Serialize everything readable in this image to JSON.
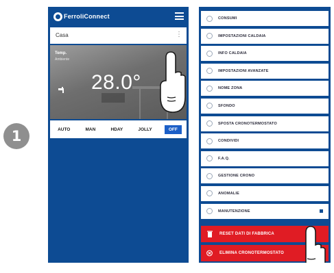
{
  "step": {
    "number": "1"
  },
  "left_phone": {
    "brand": "FerroliConnect",
    "zone": "Casa",
    "temp_label": "Temp.",
    "temp_sub": "Ambiente",
    "temperature": "28.0°",
    "modes": [
      {
        "label": "AUTO",
        "active": false
      },
      {
        "label": "MAN",
        "active": false
      },
      {
        "label": "HDAY",
        "active": false
      },
      {
        "label": "JOLLY",
        "active": false
      },
      {
        "label": "OFF",
        "active": true
      }
    ]
  },
  "right_phone": {
    "menu_items": [
      {
        "label": "CONSUMI"
      },
      {
        "label": "IMPOSTAZIONI CALDAIA"
      },
      {
        "label": "INFO CALDAIA"
      },
      {
        "label": "IMPOSTAZIONI AVANZATE"
      },
      {
        "label": "NOME ZONA"
      },
      {
        "label": "SFONDO"
      },
      {
        "label": "SPOSTA CRONOTERMOSTATO"
      },
      {
        "label": "CONDIVIDI"
      },
      {
        "label": "F.A.Q."
      },
      {
        "label": "GESTIONE CRONO"
      },
      {
        "label": "ANOMALIE"
      },
      {
        "label": "MANUTENZIONE"
      }
    ],
    "reset_label": "RESET DATI DI FABBRICA",
    "delete_label": "ELIMINA CRONOTERMOSTATO"
  },
  "colors": {
    "primary": "#0d4b93",
    "danger": "#e01c24",
    "accent": "#1c5fc7"
  }
}
